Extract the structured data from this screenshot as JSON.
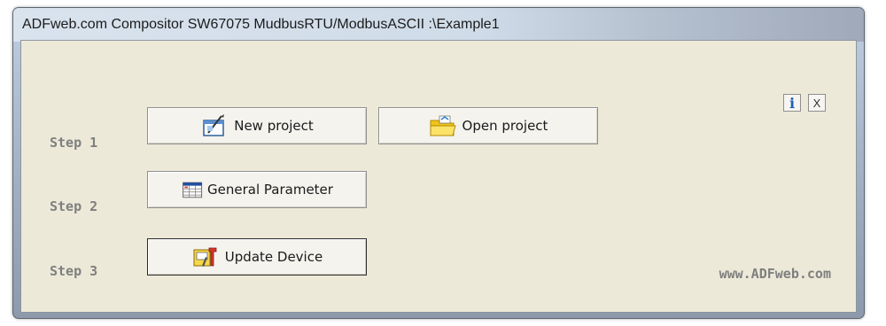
{
  "window": {
    "title": "ADFweb.com Compositor SW67075 MudbusRTU/ModbusASCII :\\Example1"
  },
  "steps": [
    {
      "label": "Step 1"
    },
    {
      "label": "Step 2"
    },
    {
      "label": "Step 3"
    }
  ],
  "buttons": {
    "new_project": {
      "label": "New project",
      "icon": "new-project-icon"
    },
    "open_project": {
      "label": "Open project",
      "icon": "folder-icon"
    },
    "general_parameter": {
      "label": "General Parameter",
      "icon": "parameter-table-icon"
    },
    "update_device": {
      "label": "Update Device",
      "icon": "update-tools-icon"
    }
  },
  "info_button": {
    "label": "i",
    "icon": "info-icon"
  },
  "close_button": {
    "label": "X",
    "icon": "close-icon"
  },
  "footer": {
    "website": "www.ADFweb.com"
  },
  "colors": {
    "client_bg": "#ece9d8",
    "step_text": "#7f7f7f",
    "info_blue": "#1f5fb5"
  }
}
